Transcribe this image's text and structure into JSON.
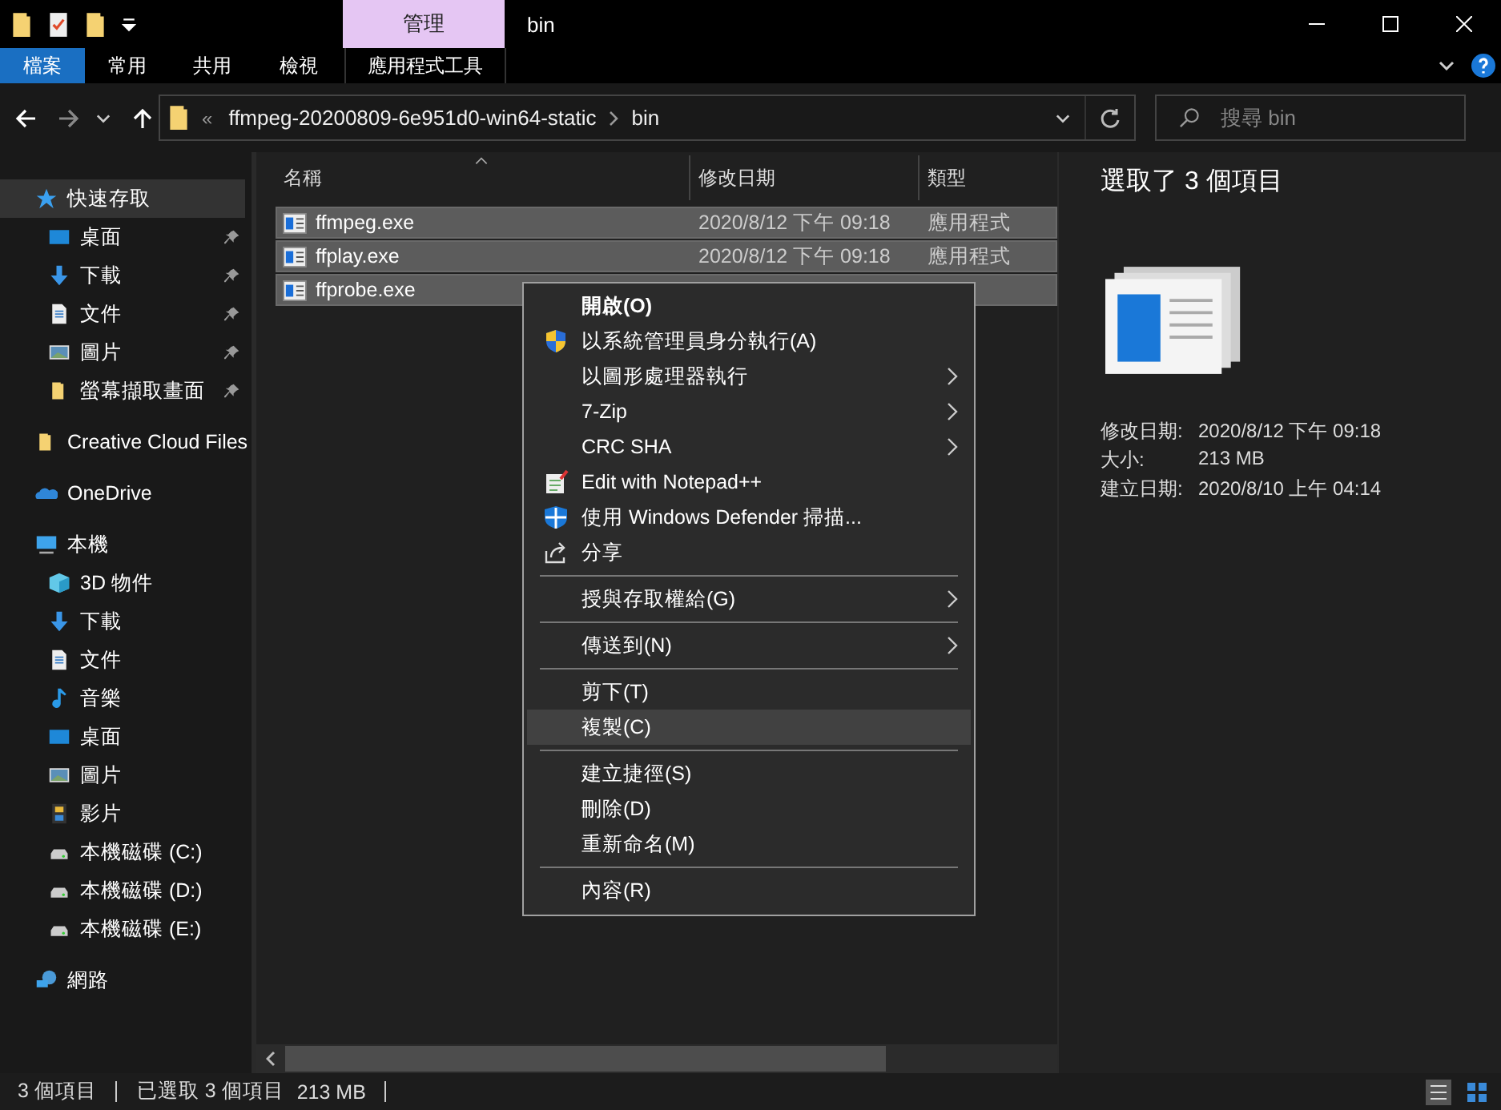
{
  "title_bar": {
    "contextual_header": "管理",
    "title": "bin"
  },
  "ribbon_tabs": [
    {
      "label": "檔案",
      "selected": true
    },
    {
      "label": "常用",
      "selected": false
    },
    {
      "label": "共用",
      "selected": false
    },
    {
      "label": "檢視",
      "selected": false
    },
    {
      "label": "應用程式工具",
      "selected": false
    }
  ],
  "address_bar": {
    "overflow_marker": "«",
    "segments": [
      "ffmpeg-20200809-6e951d0-win64-static",
      "bin"
    ]
  },
  "search": {
    "placeholder": "搜尋 bin"
  },
  "nav": [
    {
      "label": "快速存取",
      "selected": true,
      "children": [
        {
          "label": "桌面",
          "pinned": true
        },
        {
          "label": "下載",
          "pinned": true
        },
        {
          "label": "文件",
          "pinned": true
        },
        {
          "label": "圖片",
          "pinned": true
        },
        {
          "label": "螢幕擷取畫面",
          "pinned": true
        }
      ]
    },
    {
      "label": "Creative Cloud Files",
      "selected": false
    },
    {
      "label": "OneDrive",
      "selected": false
    },
    {
      "label": "本機",
      "selected": false,
      "children": [
        {
          "label": "3D 物件",
          "pinned": false
        },
        {
          "label": "下載",
          "pinned": false
        },
        {
          "label": "文件",
          "pinned": false
        },
        {
          "label": "音樂",
          "pinned": false
        },
        {
          "label": "桌面",
          "pinned": false
        },
        {
          "label": "圖片",
          "pinned": false
        },
        {
          "label": "影片",
          "pinned": false
        },
        {
          "label": "本機磁碟 (C:)",
          "pinned": false
        },
        {
          "label": "本機磁碟 (D:)",
          "pinned": false
        },
        {
          "label": "本機磁碟 (E:)",
          "pinned": false
        }
      ]
    },
    {
      "label": "網路",
      "selected": false
    }
  ],
  "file_list": {
    "columns": [
      "名稱",
      "修改日期",
      "類型"
    ],
    "rows": [
      {
        "name": "ffmpeg.exe",
        "modified": "2020/8/12 下午 09:18",
        "type": "應用程式",
        "selected": true
      },
      {
        "name": "ffplay.exe",
        "modified": "2020/8/12 下午 09:18",
        "type": "應用程式",
        "selected": true
      },
      {
        "name": "ffprobe.exe",
        "selected": true
      }
    ]
  },
  "details": {
    "heading": "選取了 3 個項目",
    "fields": [
      {
        "label": "修改日期:",
        "value": "2020/8/12 下午 09:18"
      },
      {
        "label": "大小:",
        "value": "213 MB"
      },
      {
        "label": "建立日期:",
        "value": "2020/8/10 上午 04:14"
      }
    ]
  },
  "context_menu": [
    {
      "kind": "item",
      "label": "開啟(O)",
      "default": true,
      "submenu": false,
      "selected": false
    },
    {
      "kind": "item",
      "label": "以系統管理員身分執行(A)",
      "default": false,
      "submenu": false,
      "selected": false
    },
    {
      "kind": "item",
      "label": "以圖形處理器執行",
      "default": false,
      "submenu": true,
      "selected": false
    },
    {
      "kind": "item",
      "label": "7-Zip",
      "default": false,
      "submenu": true,
      "selected": false
    },
    {
      "kind": "item",
      "label": "CRC SHA",
      "default": false,
      "submenu": true,
      "selected": false
    },
    {
      "kind": "item",
      "label": "Edit with Notepad++",
      "default": false,
      "submenu": false,
      "selected": false
    },
    {
      "kind": "item",
      "label": "使用 Windows Defender 掃描...",
      "default": false,
      "submenu": false,
      "selected": false
    },
    {
      "kind": "item",
      "label": "分享",
      "default": false,
      "submenu": false,
      "selected": false
    },
    {
      "kind": "separator"
    },
    {
      "kind": "item",
      "label": "授與存取權給(G)",
      "default": false,
      "submenu": true,
      "selected": false
    },
    {
      "kind": "separator"
    },
    {
      "kind": "item",
      "label": "傳送到(N)",
      "default": false,
      "submenu": true,
      "selected": false
    },
    {
      "kind": "separator"
    },
    {
      "kind": "item",
      "label": "剪下(T)",
      "default": false,
      "submenu": false,
      "selected": false
    },
    {
      "kind": "item",
      "label": "複製(C)",
      "default": false,
      "submenu": false,
      "selected": true
    },
    {
      "kind": "separator"
    },
    {
      "kind": "item",
      "label": "建立捷徑(S)",
      "default": false,
      "submenu": false,
      "selected": false
    },
    {
      "kind": "item",
      "label": "刪除(D)",
      "default": false,
      "submenu": false,
      "selected": false
    },
    {
      "kind": "item",
      "label": "重新命名(M)",
      "default": false,
      "submenu": false,
      "selected": false
    },
    {
      "kind": "separator"
    },
    {
      "kind": "item",
      "label": "內容(R)",
      "default": false,
      "submenu": false,
      "selected": false
    }
  ],
  "status_bar": [
    "3 個項目",
    "已選取 3 個項目",
    "213 MB"
  ]
}
